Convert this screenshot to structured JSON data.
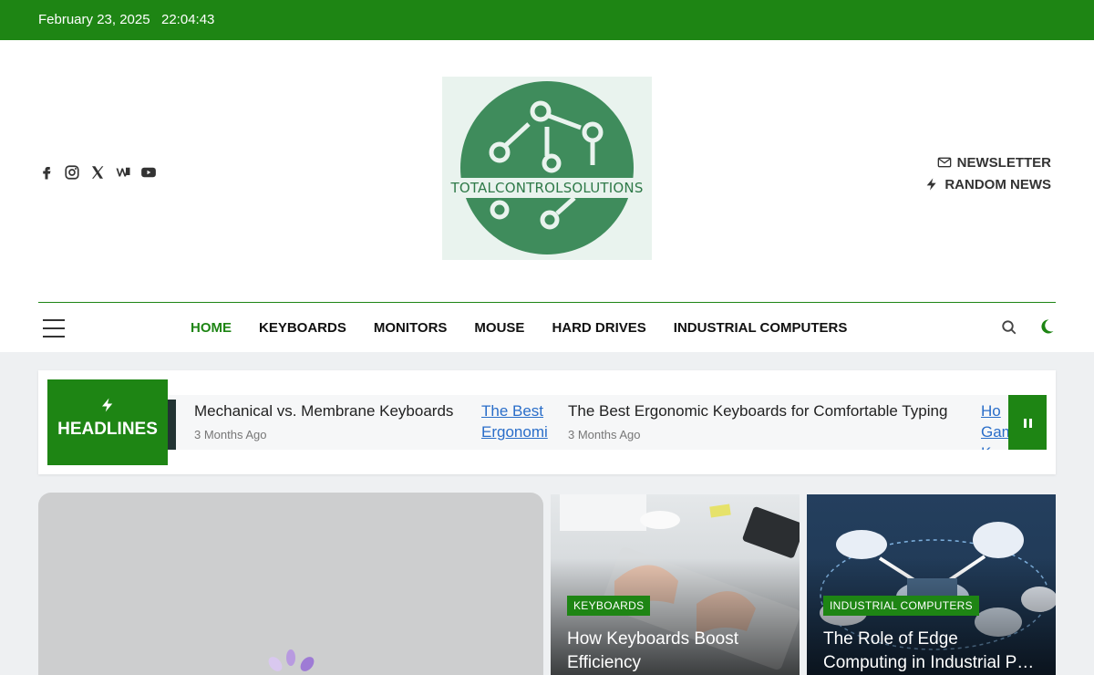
{
  "topbar": {
    "date": "February 23, 2025",
    "time": "22:04:43",
    "bg": "#1e8514"
  },
  "brand": {
    "logo_text": "TOTALCONTROLSOLUTIONS",
    "accent": "#1e8514",
    "logo_green": "#3f8c5c"
  },
  "social": [
    "facebook-icon",
    "instagram-icon",
    "x-icon",
    "wikipedia-icon",
    "youtube-icon"
  ],
  "header_links": {
    "newsletter": "NEWSLETTER",
    "random_news": "RANDOM NEWS"
  },
  "nav": {
    "items": [
      "HOME",
      "KEYBOARDS",
      "MONITORS",
      "MOUSE",
      "HARD DRIVES",
      "INDUSTRIAL COMPUTERS"
    ],
    "active": "HOME"
  },
  "ticker": {
    "label": "HEADLINES",
    "items": [
      {
        "title": "Mechanical vs. Membrane Keyboards",
        "time": "3 Months Ago"
      },
      {
        "title": "The Best Ergonomic Keyboards for Comfortable Typing",
        "time": "3 Months Ago"
      }
    ],
    "broken_img_1": "The Best Ergonomi",
    "broken_img_2": "Ho Gam K"
  },
  "cards": [
    {
      "category": "KEYBOARDS",
      "title": "How Keyboards Boost Efficiency"
    },
    {
      "category": "INDUSTRIAL COMPUTERS",
      "title": "The Role of Edge Computing in Industrial P…"
    }
  ]
}
